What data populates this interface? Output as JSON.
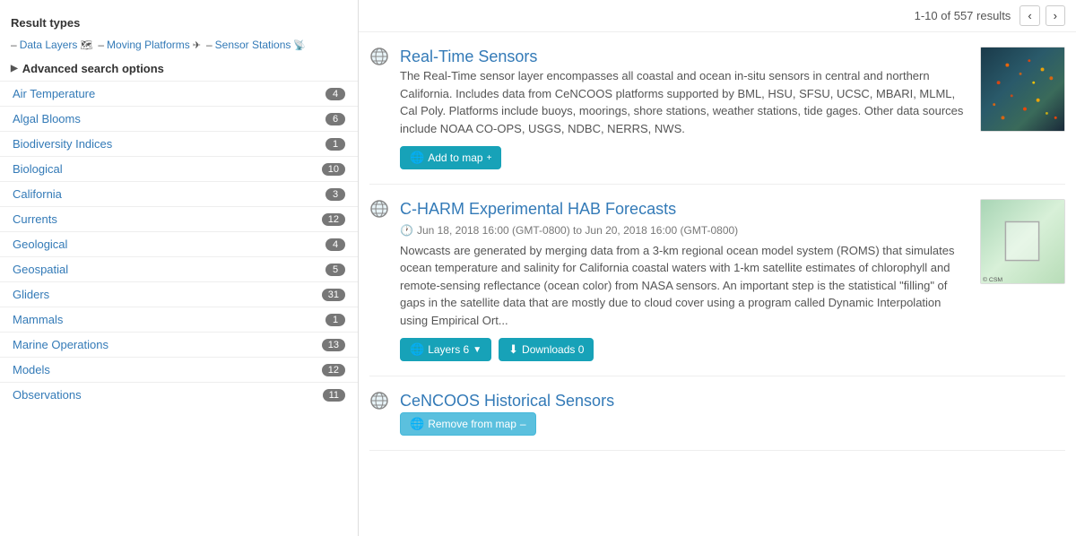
{
  "sidebar": {
    "section_title": "Result types",
    "result_types": [
      {
        "id": "data-layers",
        "label": "Data Layers",
        "icon": "–"
      },
      {
        "id": "moving-platforms",
        "label": "Moving Platforms",
        "icon": "–"
      },
      {
        "id": "sensor-stations",
        "label": "Sensor Stations",
        "icon": "–"
      }
    ],
    "advanced_toggle": "Advanced search options",
    "filters": [
      {
        "id": "air-temperature",
        "label": "Air Temperature",
        "count": "4"
      },
      {
        "id": "algal-blooms",
        "label": "Algal Blooms",
        "count": "6"
      },
      {
        "id": "biodiversity-indices",
        "label": "Biodiversity Indices",
        "count": "1"
      },
      {
        "id": "biological",
        "label": "Biological",
        "count": "10"
      },
      {
        "id": "california",
        "label": "California",
        "count": "3"
      },
      {
        "id": "currents",
        "label": "Currents",
        "count": "12"
      },
      {
        "id": "geological",
        "label": "Geological",
        "count": "4"
      },
      {
        "id": "geospatial",
        "label": "Geospatial",
        "count": "5"
      },
      {
        "id": "gliders",
        "label": "Gliders",
        "count": "31"
      },
      {
        "id": "mammals",
        "label": "Mammals",
        "count": "1"
      },
      {
        "id": "marine-operations",
        "label": "Marine Operations",
        "count": "13"
      },
      {
        "id": "models",
        "label": "Models",
        "count": "12"
      },
      {
        "id": "observations",
        "label": "Observations",
        "count": "11"
      }
    ]
  },
  "pagination": {
    "info": "1-10 of 557 results",
    "prev_label": "‹",
    "next_label": "›"
  },
  "results": [
    {
      "id": "real-time-sensors",
      "title": "Real-Time Sensors",
      "description": "The Real-Time sensor layer encompasses all coastal and ocean in-situ sensors in central and northern California. Includes data from CeNCOOS platforms supported by BML, HSU, SFSU, UCSC, MBARI, MLML, Cal Poly. Platforms include buoys, moorings, shore stations, weather stations, tide gages. Other data sources include NOAA CO-OPS, USGS, NDBC, NERRS, NWS.",
      "actions": [
        {
          "id": "add-to-map",
          "label": "Add to map",
          "type": "add",
          "icon": "+"
        }
      ],
      "has_thumb": true,
      "thumb_type": "rts"
    },
    {
      "id": "c-harm",
      "title": "C-HARM Experimental HAB Forecasts",
      "date": "Jun 18, 2018 16:00 (GMT-0800) to Jun 20, 2018 16:00 (GMT-0800)",
      "description": "Nowcasts are generated by merging data from a 3-km regional ocean model system (ROMS) that simulates ocean temperature and salinity for California coastal waters with 1-km satellite estimates of chlorophyll and remote-sensing reflectance (ocean color) from NASA sensors. An important step is the statistical \"filling\" of gaps in the satellite data that are mostly due to cloud cover using a program called Dynamic Interpolation using Empirical Ort...",
      "actions": [
        {
          "id": "layers",
          "label": "Layers 6",
          "type": "layers",
          "icon": "▼"
        },
        {
          "id": "downloads",
          "label": "Downloads 0",
          "type": "downloads",
          "icon": "↓"
        }
      ],
      "has_thumb": true,
      "thumb_type": "charm"
    },
    {
      "id": "cencoos-historical",
      "title": "CeNCOOS Historical Sensors",
      "description": "",
      "actions": [
        {
          "id": "remove-from-map",
          "label": "Remove from map",
          "type": "remove",
          "icon": "–"
        }
      ],
      "has_thumb": false,
      "thumb_type": null
    }
  ]
}
